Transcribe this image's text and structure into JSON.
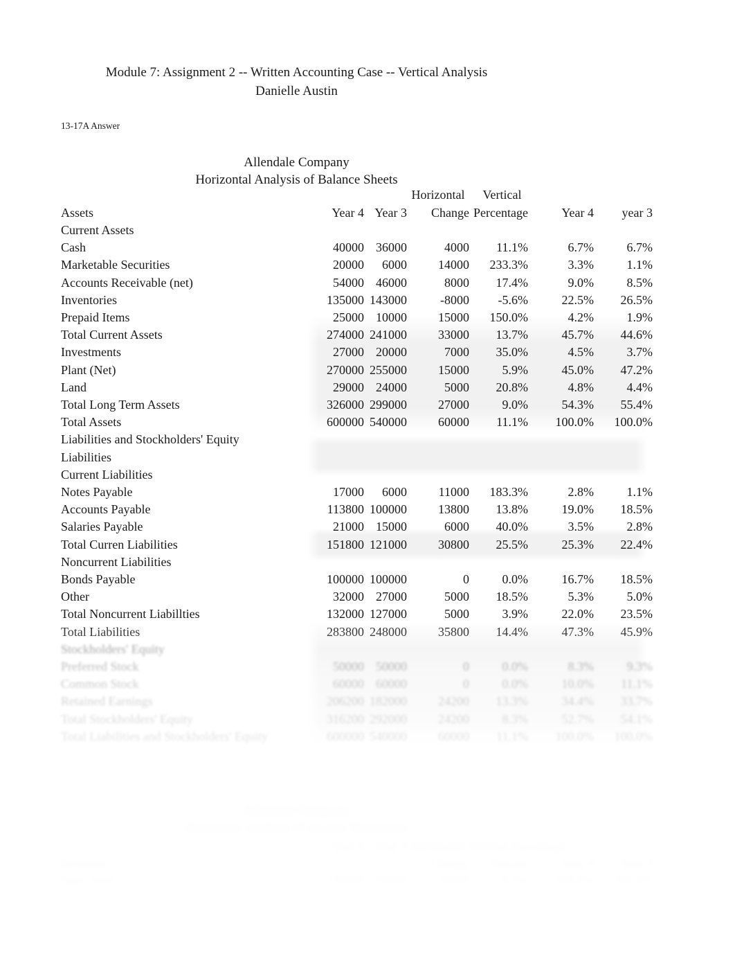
{
  "document": {
    "title_line1": "Module 7: Assignment 2 -- Written Accounting Case -- Vertical Analysis",
    "title_line2": "Danielle Austin",
    "answer_label": "13-17A Answer"
  },
  "balance_sheet": {
    "company": "Allendale Company",
    "statement_title": "Horizontal Analysis of Balance Sheets",
    "group_headers": {
      "horizontal": "Horizontal",
      "vertical": "Vertical"
    },
    "columns": {
      "label": "Assets",
      "year4": "Year 4",
      "year3": "Year 3",
      "change": "Change",
      "percentage": "Percentage",
      "vertical_year4": "Year 4",
      "vertical_year3": "year 3"
    },
    "rows": [
      {
        "label": "Current Assets",
        "year4": "",
        "year3": "",
        "change": "",
        "percentage": "",
        "v_year4": "",
        "v_year3": ""
      },
      {
        "label": "Cash",
        "year4": "40000",
        "year3": "36000",
        "change": "4000",
        "percentage": "11.1%",
        "v_year4": "6.7%",
        "v_year3": "6.7%"
      },
      {
        "label": "Marketable Securities",
        "year4": "20000",
        "year3": "6000",
        "change": "14000",
        "percentage": "233.3%",
        "v_year4": "3.3%",
        "v_year3": "1.1%"
      },
      {
        "label": "Accounts Receivable (net)",
        "year4": "54000",
        "year3": "46000",
        "change": "8000",
        "percentage": "17.4%",
        "v_year4": "9.0%",
        "v_year3": "8.5%"
      },
      {
        "label": "Inventories",
        "year4": "135000",
        "year3": "143000",
        "change": "-8000",
        "percentage": "-5.6%",
        "v_year4": "22.5%",
        "v_year3": "26.5%"
      },
      {
        "label": "Prepaid Items",
        "year4": "25000",
        "year3": "10000",
        "change": "15000",
        "percentage": "150.0%",
        "v_year4": "4.2%",
        "v_year3": "1.9%"
      },
      {
        "label": "Total Current Assets",
        "year4": "274000",
        "year3": "241000",
        "change": "33000",
        "percentage": "13.7%",
        "v_year4": "45.7%",
        "v_year3": "44.6%"
      },
      {
        "label": "Investments",
        "year4": "27000",
        "year3": "20000",
        "change": "7000",
        "percentage": "35.0%",
        "v_year4": "4.5%",
        "v_year3": "3.7%"
      },
      {
        "label": "Plant (Net)",
        "year4": "270000",
        "year3": "255000",
        "change": "15000",
        "percentage": "5.9%",
        "v_year4": "45.0%",
        "v_year3": "47.2%"
      },
      {
        "label": "Land",
        "year4": "29000",
        "year3": "24000",
        "change": "5000",
        "percentage": "20.8%",
        "v_year4": "4.8%",
        "v_year3": "4.4%"
      },
      {
        "label": "Total Long Term Assets",
        "year4": "326000",
        "year3": "299000",
        "change": "27000",
        "percentage": "9.0%",
        "v_year4": "54.3%",
        "v_year3": "55.4%"
      },
      {
        "label": "Total Assets",
        "year4": "600000",
        "year3": "540000",
        "change": "60000",
        "percentage": "11.1%",
        "v_year4": "100.0%",
        "v_year3": "100.0%"
      },
      {
        "label": "Liabilities and Stockholders' Equity",
        "year4": "",
        "year3": "",
        "change": "",
        "percentage": "",
        "v_year4": "",
        "v_year3": ""
      },
      {
        "label": "Liabilities",
        "year4": "",
        "year3": "",
        "change": "",
        "percentage": "",
        "v_year4": "",
        "v_year3": ""
      },
      {
        "label": "Current Liabilities",
        "year4": "",
        "year3": "",
        "change": "",
        "percentage": "",
        "v_year4": "",
        "v_year3": ""
      },
      {
        "label": "Notes Payable",
        "year4": "17000",
        "year3": "6000",
        "change": "11000",
        "percentage": "183.3%",
        "v_year4": "2.8%",
        "v_year3": "1.1%"
      },
      {
        "label": "Accounts Payable",
        "year4": "113800",
        "year3": "100000",
        "change": "13800",
        "percentage": "13.8%",
        "v_year4": "19.0%",
        "v_year3": "18.5%"
      },
      {
        "label": "Salaries Payable",
        "year4": "21000",
        "year3": "15000",
        "change": "6000",
        "percentage": "40.0%",
        "v_year4": "3.5%",
        "v_year3": "2.8%"
      },
      {
        "label": "Total Curren Liabilities",
        "year4": "151800",
        "year3": "121000",
        "change": "30800",
        "percentage": "25.5%",
        "v_year4": "25.3%",
        "v_year3": "22.4%"
      },
      {
        "label": "Noncurrent Liabilities",
        "year4": "",
        "year3": "",
        "change": "",
        "percentage": "",
        "v_year4": "",
        "v_year3": ""
      },
      {
        "label": "Bonds Payable",
        "year4": "100000",
        "year3": "100000",
        "change": "0",
        "percentage": "0.0%",
        "v_year4": "16.7%",
        "v_year3": "18.5%"
      },
      {
        "label": "Other",
        "year4": "32000",
        "year3": "27000",
        "change": "5000",
        "percentage": "18.5%",
        "v_year4": "5.3%",
        "v_year3": "5.0%"
      },
      {
        "label": "Total Noncurrent Liabillties",
        "year4": "132000",
        "year3": "127000",
        "change": "5000",
        "percentage": "3.9%",
        "v_year4": "22.0%",
        "v_year3": "23.5%"
      },
      {
        "label": "Total Liabilities",
        "year4": "283800",
        "year3": "248000",
        "change": "35800",
        "percentage": "14.4%",
        "v_year4": "47.3%",
        "v_year3": "45.9%"
      }
    ],
    "faded_rows": [
      {
        "label": "Stockholders' Equity",
        "year4": "",
        "year3": "",
        "change": "",
        "percentage": "",
        "v_year4": "",
        "v_year3": ""
      },
      {
        "label": "Preferred Stock",
        "year4": "50000",
        "year3": "50000",
        "change": "0",
        "percentage": "0.0%",
        "v_year4": "8.3%",
        "v_year3": "9.3%"
      },
      {
        "label": "Common Stock",
        "year4": "60000",
        "year3": "60000",
        "change": "0",
        "percentage": "0.0%",
        "v_year4": "10.0%",
        "v_year3": "11.1%"
      },
      {
        "label": "Retained Earnings",
        "year4": "206200",
        "year3": "182000",
        "change": "24200",
        "percentage": "13.3%",
        "v_year4": "34.4%",
        "v_year3": "33.7%"
      },
      {
        "label": "Total Stockholders' Equity",
        "year4": "316200",
        "year3": "292000",
        "change": "24200",
        "percentage": "8.3%",
        "v_year4": "52.7%",
        "v_year3": "54.1%"
      },
      {
        "label": "Total Liabilities and Stockholders' Equity",
        "year4": "600000",
        "year3": "540000",
        "change": "60000",
        "percentage": "11.1%",
        "v_year4": "100.0%",
        "v_year3": "100.0%"
      }
    ]
  },
  "income_statement": {
    "company": "Allendale Company",
    "statement_title": "Horizontal Analysis of Income Statements",
    "group_headers": {
      "horizontal": "Horizontal",
      "vertical": "Vertical Percentage"
    },
    "columns": {
      "label": "Revenues",
      "year4": "Year 4",
      "year3": "Year 3",
      "change": "Change",
      "percentage": "Percent",
      "vertical_year4": "Year 4",
      "vertical_year3": "Year 3"
    },
    "rows": [
      {
        "label": "Sales (net)",
        "year4": "230000",
        "year3": "210000",
        "change": "20000",
        "percentage": "9.5%",
        "v_year4": "100.0%",
        "v_year3": "100.0%"
      }
    ]
  }
}
